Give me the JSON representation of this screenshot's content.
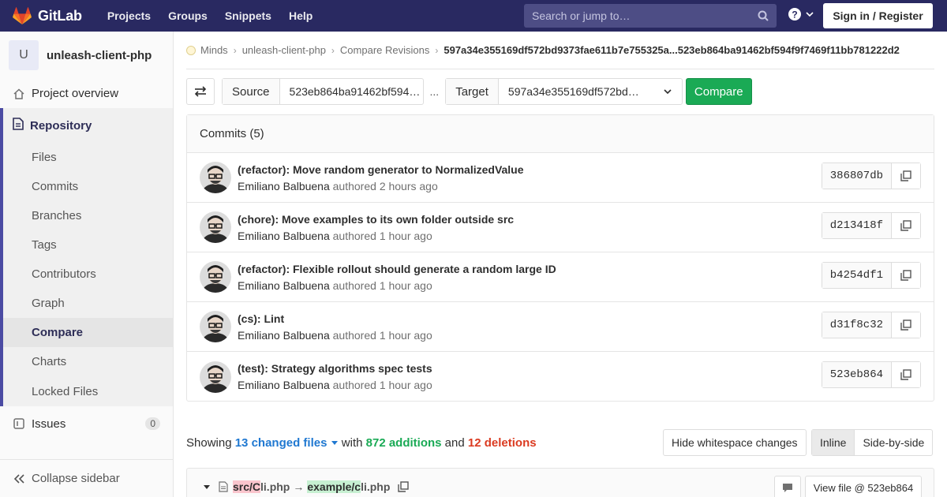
{
  "navbar": {
    "brand": "GitLab",
    "links": [
      "Projects",
      "Groups",
      "Snippets",
      "Help"
    ],
    "search_placeholder": "Search or jump to…",
    "signin_label": "Sign in / Register",
    "bg_color": "#292961"
  },
  "sidebar": {
    "project_initial": "U",
    "project_name": "unleash-client-php",
    "overview_label": "Project overview",
    "repository_label": "Repository",
    "repo_items": [
      "Files",
      "Commits",
      "Branches",
      "Tags",
      "Contributors",
      "Graph",
      "Compare",
      "Charts",
      "Locked Files"
    ],
    "active_item": "Compare",
    "issues_label": "Issues",
    "issues_count": "0",
    "collapse_label": "Collapse sidebar"
  },
  "breadcrumbs": {
    "items": [
      "Minds",
      "unleash-client-php",
      "Compare Revisions"
    ],
    "current": "597a34e355169df572bd9373fae611b7e755325a...523eb864ba91462bf594f9f7469f11bb781222d2"
  },
  "compare": {
    "source_label": "Source",
    "source_value": "523eb864ba91462bf594…",
    "ellipsis": "...",
    "target_label": "Target",
    "target_value": "597a34e355169df572bd…",
    "compare_button": "Compare"
  },
  "commits": {
    "header": "Commits (5)",
    "authored_word": "authored",
    "items": [
      {
        "title": "(refactor): Move random generator to NormalizedValue",
        "author": "Emiliano Balbuena",
        "time": "2 hours ago",
        "sha": "386807db"
      },
      {
        "title": "(chore): Move examples to its own folder outside src",
        "author": "Emiliano Balbuena",
        "time": "1 hour ago",
        "sha": "d213418f"
      },
      {
        "title": "(refactor): Flexible rollout should generate a random large ID",
        "author": "Emiliano Balbuena",
        "time": "1 hour ago",
        "sha": "b4254df1"
      },
      {
        "title": "(cs): Lint",
        "author": "Emiliano Balbuena",
        "time": "1 hour ago",
        "sha": "d31f8c32"
      },
      {
        "title": "(test): Strategy algorithms spec tests",
        "author": "Emiliano Balbuena",
        "time": "1 hour ago",
        "sha": "523eb864"
      }
    ]
  },
  "changes": {
    "showing": "Showing",
    "files_changed": "13 changed files",
    "with": "with",
    "additions": "872 additions",
    "and": "and",
    "deletions": "12 deletions",
    "whitespace_button": "Hide whitespace changes",
    "inline_label": "Inline",
    "side_by_side_label": "Side-by-side"
  },
  "file": {
    "old_prefix_removed": "src/C",
    "old_suffix": "li.php",
    "arrow": "→",
    "new_prefix_added": "example/c",
    "new_suffix": "li.php",
    "view_file_label": "View file @ 523eb864"
  }
}
